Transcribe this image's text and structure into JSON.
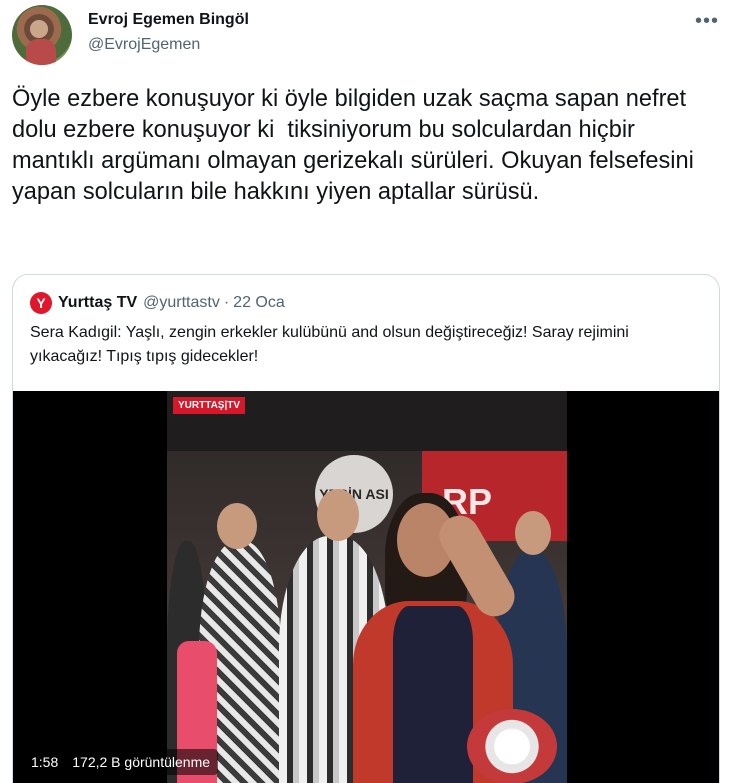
{
  "author": {
    "name": "Evroj Egemen Bingöl",
    "handle": "@EvrojEgemen",
    "avatar_icon": "avatar"
  },
  "more_icon": "more-horizontal-icon",
  "tweet": {
    "text": "Öyle ezbere konuşuyor ki öyle bilgiden uzak saçma sapan nefret dolu ezbere konuşuyor ki  tiksiniyorum bu solculardan hiçbir mantıklı argümanı olmayan gerizekalı sürüleri. Okuyan felsefesini yapan solcuların bile hakkını yiyen aptallar sürüsü."
  },
  "quote": {
    "logo_glyph": "Y",
    "name": "Yurttaş TV",
    "handle": "@yurttastv",
    "separator": "·",
    "date": "22 Oca",
    "text": "Sera Kadıgil: Yaşlı, zengin erkekler kulübünü and olsun değiştireceğiz! Saray rejimini yıkacağız! Tıpış tıpış gidecekler!",
    "video": {
      "channel_tag": "YURTTAŞ|TV",
      "background_logo": "YERİN ASI",
      "banner_text": "RP",
      "time": "1:58",
      "views": "172,2 B görüntülenme"
    }
  },
  "colors": {
    "text_primary": "#0f1419",
    "text_secondary": "#536471",
    "border": "#cfd9de",
    "brand_red": "#e0162b"
  }
}
